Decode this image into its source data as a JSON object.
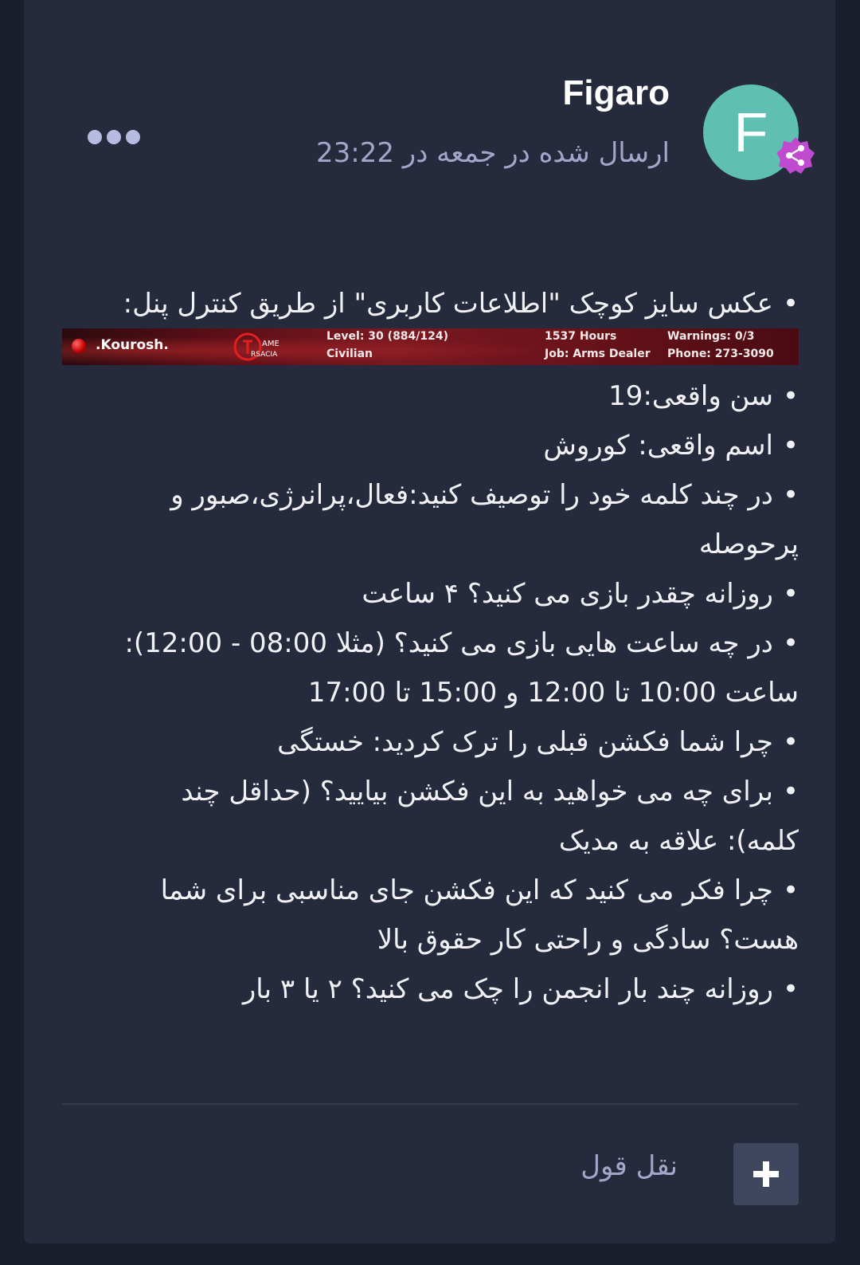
{
  "post": {
    "author": {
      "name": "Figaro",
      "avatar_letter": "F",
      "avatar_color": "#5fbfb0",
      "badge_icon": "share-icon",
      "badge_color": "#c04ad0"
    },
    "timestamp": "ارسال شده در جمعه در 23:22",
    "more_icon": "more-dots-icon",
    "lines": [
      "عکس سایز کوچک \"اطلاعات کاربری\" از طریق کنترل پنل:",
      "سن واقعی:19",
      "اسم واقعی: کوروش",
      "در چند کلمه خود را توصیف کنید:فعال،پرانرژی،صبور و",
      "پرحوصله",
      "روزانه چقدر بازی می کنید؟ ۴ ساعت",
      "در چه ساعت هایی بازی می کنید؟ (مثلا 08:00 - 12:00):",
      "ساعت 10:00 تا 12:00 و 15:00 تا 17:00",
      "چرا شما فکشن قبلی را ترک کردید: خستگی",
      "برای چه می خواهید به این فکشن بیایید؟ (حداقل چند",
      "کلمه): علاقه به مدیک",
      "چرا فکر می کنید که این فکشن جای مناسبی برای شما",
      "هست؟ سادگی و راحتی کار حقوق بالا",
      "روزانه چند بار انجمن را چک می کنید؟ ۲ یا ۳ بار"
    ],
    "bullet": "•",
    "signature": {
      "name": ".Kourosh.",
      "logo_text_top": "AME",
      "logo_text_bottom": "RSACIA",
      "level": "Level: 30 (884/124)",
      "rank": "Civilian",
      "hours": "1537 Hours",
      "job": "Job: Arms Dealer",
      "warnings": "Warnings: 0/3",
      "phone": "Phone: 273-3090"
    },
    "footer": {
      "quote_label": "نقل قول",
      "add_icon": "plus-icon"
    }
  }
}
